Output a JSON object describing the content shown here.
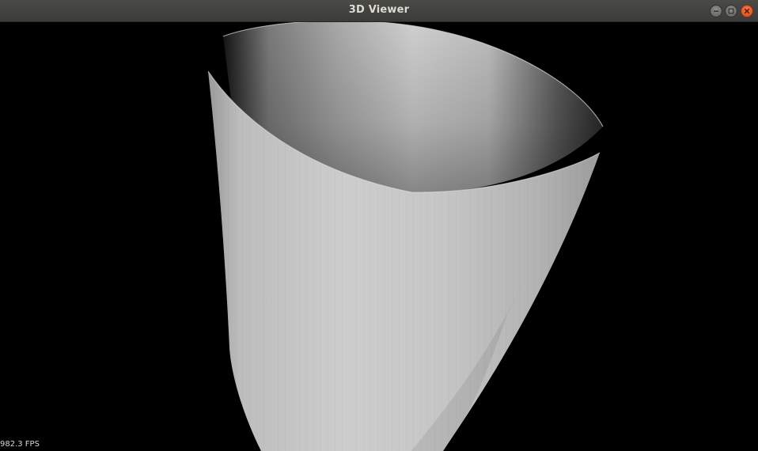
{
  "window": {
    "title": "3D Viewer",
    "controls": {
      "minimize_icon": "minimize-icon",
      "maximize_icon": "maximize-icon",
      "close_icon": "close-icon"
    }
  },
  "viewport": {
    "background": "#000000",
    "model_color": "#c8c8c8",
    "fps_text": "982.3 FPS"
  }
}
